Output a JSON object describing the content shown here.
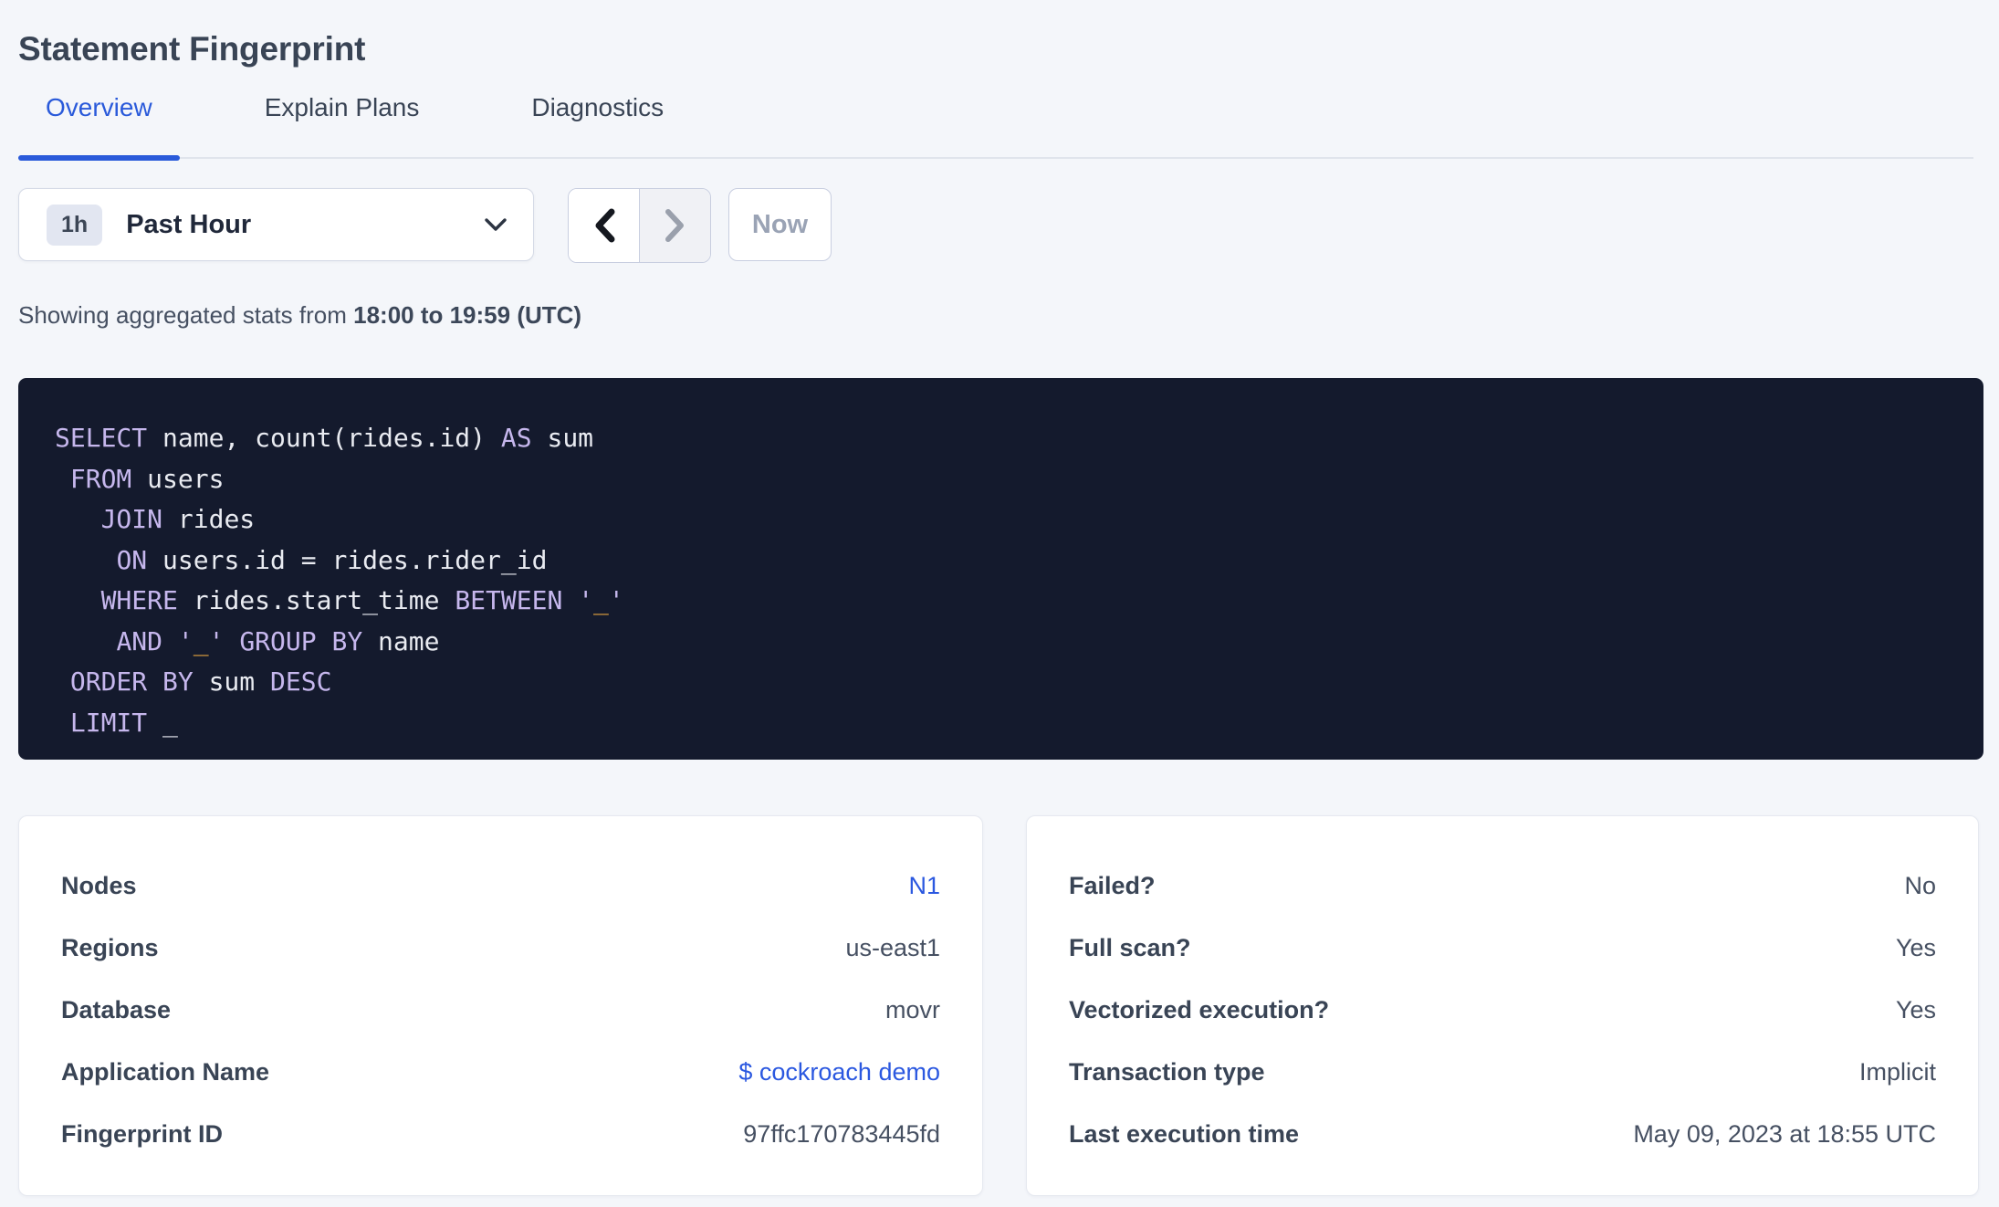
{
  "header": {
    "title": "Statement Fingerprint"
  },
  "tabs": {
    "items": [
      {
        "label": "Overview",
        "active": true
      },
      {
        "label": "Explain Plans",
        "active": false
      },
      {
        "label": "Diagnostics",
        "active": false
      }
    ]
  },
  "time_controls": {
    "badge": "1h",
    "selected_range": "Past Hour",
    "now_label": "Now"
  },
  "stats_summary": {
    "prefix": "Showing aggregated stats from ",
    "range": "18:00 to 19:59 (UTC)"
  },
  "sql_box": {
    "lines": [
      [
        {
          "t": "SELECT",
          "c": "kw"
        },
        {
          "t": " name, count(rides.id) ",
          "c": "pl"
        },
        {
          "t": "AS",
          "c": "kw"
        },
        {
          "t": " sum",
          "c": "pl"
        }
      ],
      [
        {
          "t": " ",
          "c": "pl"
        },
        {
          "t": "FROM",
          "c": "kw"
        },
        {
          "t": " users",
          "c": "pl"
        }
      ],
      [
        {
          "t": "   ",
          "c": "pl"
        },
        {
          "t": "JOIN",
          "c": "kw"
        },
        {
          "t": " rides",
          "c": "pl"
        }
      ],
      [
        {
          "t": "    ",
          "c": "pl"
        },
        {
          "t": "ON",
          "c": "kw"
        },
        {
          "t": " users.id = rides.rider_id",
          "c": "pl"
        }
      ],
      [
        {
          "t": "   ",
          "c": "pl"
        },
        {
          "t": "WHERE",
          "c": "kw"
        },
        {
          "t": " rides.start_time ",
          "c": "pl"
        },
        {
          "t": "BETWEEN",
          "c": "kw"
        },
        {
          "t": " ",
          "c": "pl"
        },
        {
          "t": "'",
          "c": "kw"
        },
        {
          "t": "_",
          "c": "str"
        },
        {
          "t": "'",
          "c": "kw"
        }
      ],
      [
        {
          "t": "    ",
          "c": "pl"
        },
        {
          "t": "AND",
          "c": "kw"
        },
        {
          "t": " ",
          "c": "pl"
        },
        {
          "t": "'",
          "c": "kw"
        },
        {
          "t": "_",
          "c": "str"
        },
        {
          "t": "'",
          "c": "kw"
        },
        {
          "t": " ",
          "c": "pl"
        },
        {
          "t": "GROUP BY",
          "c": "kw"
        },
        {
          "t": " name",
          "c": "pl"
        }
      ],
      [
        {
          "t": " ",
          "c": "pl"
        },
        {
          "t": "ORDER BY",
          "c": "kw"
        },
        {
          "t": " sum ",
          "c": "pl"
        },
        {
          "t": "DESC",
          "c": "kw"
        }
      ],
      [
        {
          "t": " ",
          "c": "pl"
        },
        {
          "t": "LIMIT",
          "c": "kw"
        },
        {
          "t": " _",
          "c": "pl"
        }
      ]
    ]
  },
  "left_card": {
    "rows": [
      {
        "label": "Nodes",
        "value": "N1",
        "link": true
      },
      {
        "label": "Regions",
        "value": "us-east1",
        "link": false
      },
      {
        "label": "Database",
        "value": "movr",
        "link": false
      },
      {
        "label": "Application Name",
        "value": "$ cockroach demo",
        "link": true
      },
      {
        "label": "Fingerprint ID",
        "value": "97ffc170783445fd",
        "link": false
      }
    ]
  },
  "right_card": {
    "rows": [
      {
        "label": "Failed?",
        "value": "No",
        "link": false
      },
      {
        "label": "Full scan?",
        "value": "Yes",
        "link": false
      },
      {
        "label": "Vectorized execution?",
        "value": "Yes",
        "link": false
      },
      {
        "label": "Transaction type",
        "value": "Implicit",
        "link": false
      },
      {
        "label": "Last execution time",
        "value": "May 09, 2023 at 18:55 UTC",
        "link": false
      }
    ]
  },
  "colors": {
    "accent_blue": "#2a5ada",
    "link_blue": "#2b58e0",
    "page_background": "#f4f6fa",
    "sql_background": "#141a2d",
    "sql_keyword": "#c6b7ed",
    "sql_plain": "#e9ebf1",
    "sql_literal": "#e2a33f",
    "label_dark": "#394455",
    "disabled_gray": "#9aa3b5"
  }
}
